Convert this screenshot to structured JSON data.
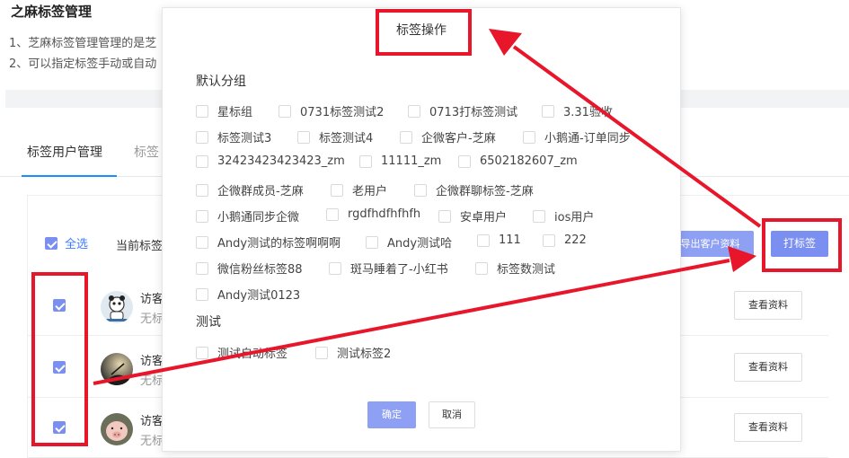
{
  "page": {
    "title": "之麻标签管理",
    "desc1": "1、芝麻标签管理管理的是芝",
    "desc2": "2、可以指定标签手动或自动"
  },
  "tabs": [
    {
      "label": "标签用户管理"
    },
    {
      "label": "标签"
    }
  ],
  "toolbar": {
    "select_all": "全选",
    "current_tag": "当前标签",
    "export_label": "导出客户资料",
    "tag_label": "打标签"
  },
  "rows": [
    {
      "name": "访客",
      "sub": "无标"
    },
    {
      "name": "访客",
      "sub": "无标"
    },
    {
      "name": "访客",
      "sub": "无标"
    }
  ],
  "row_button": "查看资料",
  "modal": {
    "title": "标签操作",
    "groups": [
      {
        "name": "默认分组",
        "tags": [
          "星标组",
          "0731标签测试2",
          "0713打标签测试",
          "3.31验收",
          "标签测试3",
          "标签测试4",
          "企微客户-芝麻",
          "小鹅通-订单同步",
          "32423423423423_zm",
          "11111_zm",
          "6502182607_zm",
          "企微群成员-芝麻",
          "老用户",
          "企微群聊标签-芝麻",
          "小鹅通同步企微",
          "rgdfhdfhfhfh",
          "安卓用户",
          "ios用户",
          "Andy测试的标签啊啊啊",
          "Andy测试哈",
          "111",
          "222",
          "微信粉丝标签88",
          "斑马睡着了-小红书",
          "标签数测试",
          "Andy测试0123"
        ]
      },
      {
        "name": "测试",
        "tags": [
          "测试自动标签",
          "测试标签2"
        ]
      }
    ],
    "ok_label": "确定",
    "cancel_label": "取消"
  },
  "colors": {
    "primary": "#7a8ff0",
    "link": "#3d7cff",
    "annotation": "#e8162a"
  }
}
